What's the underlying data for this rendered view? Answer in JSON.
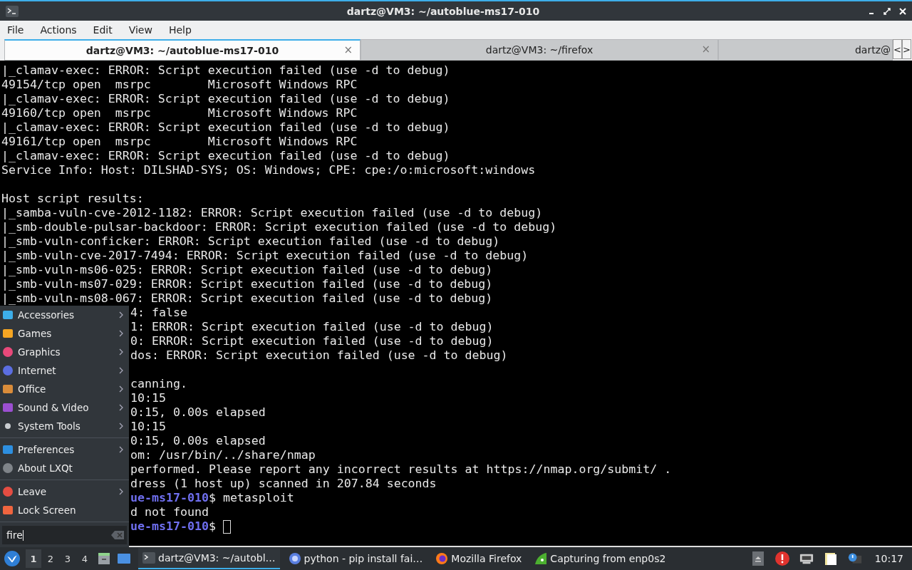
{
  "window": {
    "title": "dartz@VM3: ~/autoblue-ms17-010"
  },
  "menu_bar": [
    "File",
    "Actions",
    "Edit",
    "View",
    "Help"
  ],
  "tabs": [
    {
      "label": "dartz@VM3: ~/autoblue-ms17-010",
      "selected": true,
      "close": "×"
    },
    {
      "label": "dartz@VM3: ~/firefox",
      "selected": false,
      "close": "×"
    },
    {
      "label": "dartz@",
      "selected": false
    }
  ],
  "tab_scroll": [
    "<",
    ">"
  ],
  "terminal": {
    "lines": [
      {
        "text": "|_clamav-exec: ERROR: Script execution failed (use -d to debug)"
      },
      {
        "text": "49154/tcp open  msrpc        Microsoft Windows RPC"
      },
      {
        "text": "|_clamav-exec: ERROR: Script execution failed (use -d to debug)"
      },
      {
        "text": "49160/tcp open  msrpc        Microsoft Windows RPC"
      },
      {
        "text": "|_clamav-exec: ERROR: Script execution failed (use -d to debug)"
      },
      {
        "text": "49161/tcp open  msrpc        Microsoft Windows RPC"
      },
      {
        "text": "|_clamav-exec: ERROR: Script execution failed (use -d to debug)"
      },
      {
        "text": "Service Info: Host: DILSHAD-SYS; OS: Windows; CPE: cpe:/o:microsoft:windows"
      },
      {
        "text": "Host script results:",
        "gap_before": true
      },
      {
        "text": "|_samba-vuln-cve-2012-1182: ERROR: Script execution failed (use -d to debug)"
      },
      {
        "text": "|_smb-double-pulsar-backdoor: ERROR: Script execution failed (use -d to debug)"
      },
      {
        "text": "|_smb-vuln-conficker: ERROR: Script execution failed (use -d to debug)"
      },
      {
        "text": "|_smb-vuln-cve-2017-7494: ERROR: Script execution failed (use -d to debug)"
      },
      {
        "text": "|_smb-vuln-ms06-025: ERROR: Script execution failed (use -d to debug)"
      },
      {
        "text": "|_smb-vuln-ms07-029: ERROR: Script execution failed (use -d to debug)"
      },
      {
        "text": "|_smb-vuln-ms08-067: ERROR: Script execution failed (use -d to debug)"
      }
    ],
    "lines_beside_menu": [
      {
        "text": "4: false"
      },
      {
        "text": "1: ERROR: Script execution failed (use -d to debug)"
      },
      {
        "text": "0: ERROR: Script execution failed (use -d to debug)"
      },
      {
        "text": "dos: ERROR: Script execution failed (use -d to debug)"
      },
      {
        "text": "canning.",
        "gap_before": true
      },
      {
        "text": "10:15"
      },
      {
        "text": "0:15, 0.00s elapsed"
      },
      {
        "text": "10:15"
      },
      {
        "text": "0:15, 0.00s elapsed"
      },
      {
        "text": "om: /usr/bin/../share/nmap"
      },
      {
        "text": "performed. Please report any incorrect results at https://nmap.org/submit/ ."
      },
      {
        "text": "dress (1 host up) scanned in 207.84 seconds"
      },
      {
        "kind": "prompt",
        "prompt": "ue-ms17-010",
        "text": "$ metasploit",
        "cursor": false
      },
      {
        "text": "d not found"
      },
      {
        "kind": "prompt",
        "prompt": "ue-ms17-010",
        "text": "$ ",
        "cursor": true
      }
    ]
  },
  "app_menu": {
    "sections": [
      [
        {
          "label": "Accessories",
          "submenu": true
        },
        {
          "label": "Games",
          "submenu": true
        },
        {
          "label": "Graphics",
          "submenu": true
        },
        {
          "label": "Internet",
          "submenu": true
        },
        {
          "label": "Office",
          "submenu": true
        },
        {
          "label": "Sound & Video",
          "submenu": true
        },
        {
          "label": "System Tools",
          "submenu": true
        }
      ],
      [
        {
          "label": "Preferences",
          "submenu": true
        },
        {
          "label": "About LXQt",
          "submenu": false
        }
      ],
      [
        {
          "label": "Leave",
          "submenu": true
        },
        {
          "label": "Lock Screen",
          "submenu": false
        }
      ]
    ],
    "search": {
      "value": "fire"
    }
  },
  "taskbar": {
    "desktops": [
      {
        "label": "1",
        "selected": true
      },
      {
        "label": "2",
        "selected": false
      },
      {
        "label": "3",
        "selected": false
      },
      {
        "label": "4",
        "selected": false
      }
    ],
    "tasks": [
      {
        "label": "dartz@VM3: ~/autobl…",
        "selected": true
      },
      {
        "label": "python - pip install fai…",
        "selected": false
      },
      {
        "label": "Mozilla Firefox",
        "selected": false
      },
      {
        "label": "Capturing from enp0s2",
        "selected": false
      }
    ],
    "clock": "10:17"
  }
}
